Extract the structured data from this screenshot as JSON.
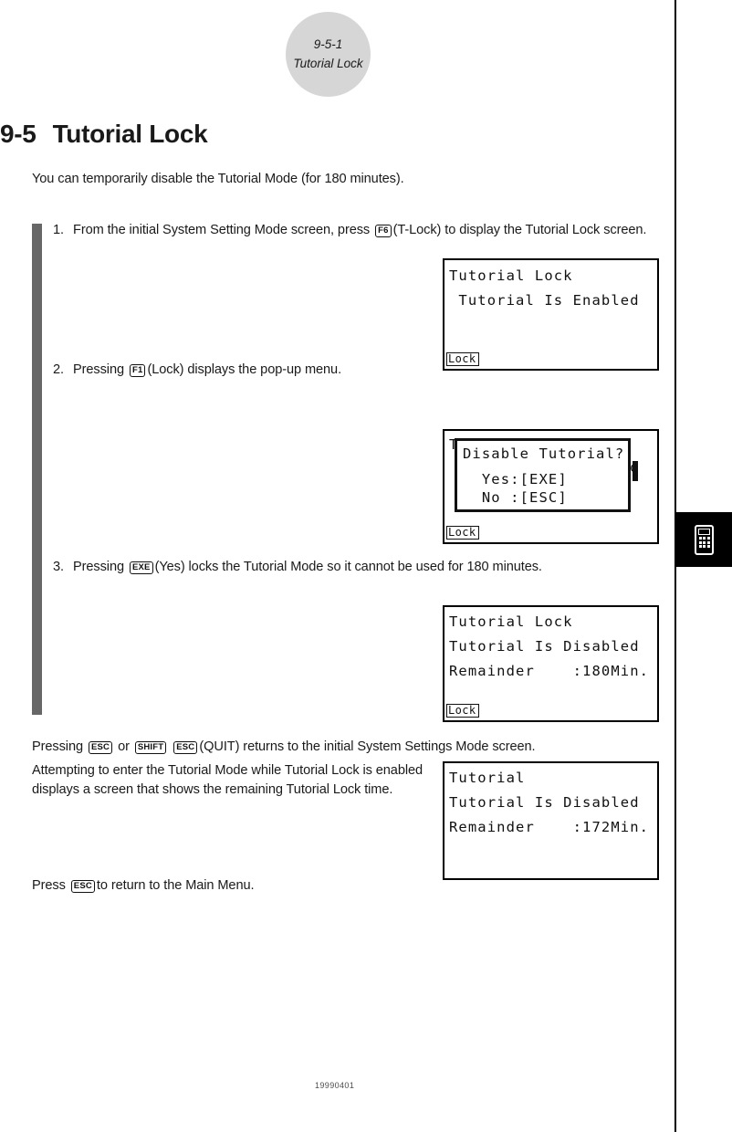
{
  "page": {
    "badge_number": "9-5-1",
    "badge_title": "Tutorial Lock",
    "footer_date": "19990401",
    "index_tab_icon": "calculator-icon"
  },
  "heading": {
    "number": "9-5",
    "title": "Tutorial Lock"
  },
  "lead_text": "You can temporarily disable the Tutorial Mode (for 180 minutes).",
  "steps": [
    {
      "marker": "1.",
      "text_before": "From the initial System Setting Mode screen, press",
      "key": "F6",
      "text_after": "(T-Lock) to display the Tutorial Lock screen."
    },
    {
      "marker": "2.",
      "text_before": "Pressing",
      "key": "F1",
      "text_after": "(Lock) displays the pop-up menu."
    },
    {
      "marker": "3.",
      "text_before": "Pressing",
      "key": "EXE",
      "text_after": "(Yes) locks the Tutorial Mode so it cannot be used for 180 minutes."
    }
  ],
  "paragraphs": {
    "quit": {
      "before": "Pressing",
      "key1": "ESC",
      "middle": "or",
      "key2": "SHIFT",
      "key3": "ESC",
      "after": "(QUIT) returns to the initial System Settings Mode screen."
    },
    "attempt": "Attempting to enter the Tutorial Mode while Tutorial Lock is enabled displays a screen that shows the remaining Tutorial Lock time.",
    "press_return": {
      "before": "Press",
      "key": "ESC",
      "after": "to return to the Main Menu."
    }
  },
  "screens": {
    "screen1": {
      "line1": "Tutorial Lock",
      "line2": " Tutorial Is Enabled",
      "fkey": "Lock"
    },
    "screen2": {
      "bg_line1": "Tutorial Lock",
      "bg_line2": " Tutorial Is Enabled",
      "popup_line1": "Disable Tutorial?",
      "popup_line2": "  Yes:[EXE]",
      "popup_line3": "  No :[ESC]",
      "fkey": "Lock"
    },
    "screen3": {
      "line1": "Tutorial Lock",
      "line2": "Tutorial Is Disabled",
      "line3": "Remainder    :180Min.",
      "fkey": "Lock"
    },
    "screen4": {
      "line1": "Tutorial",
      "line2": "Tutorial Is Disabled",
      "line3": "Remainder    :172Min."
    }
  }
}
